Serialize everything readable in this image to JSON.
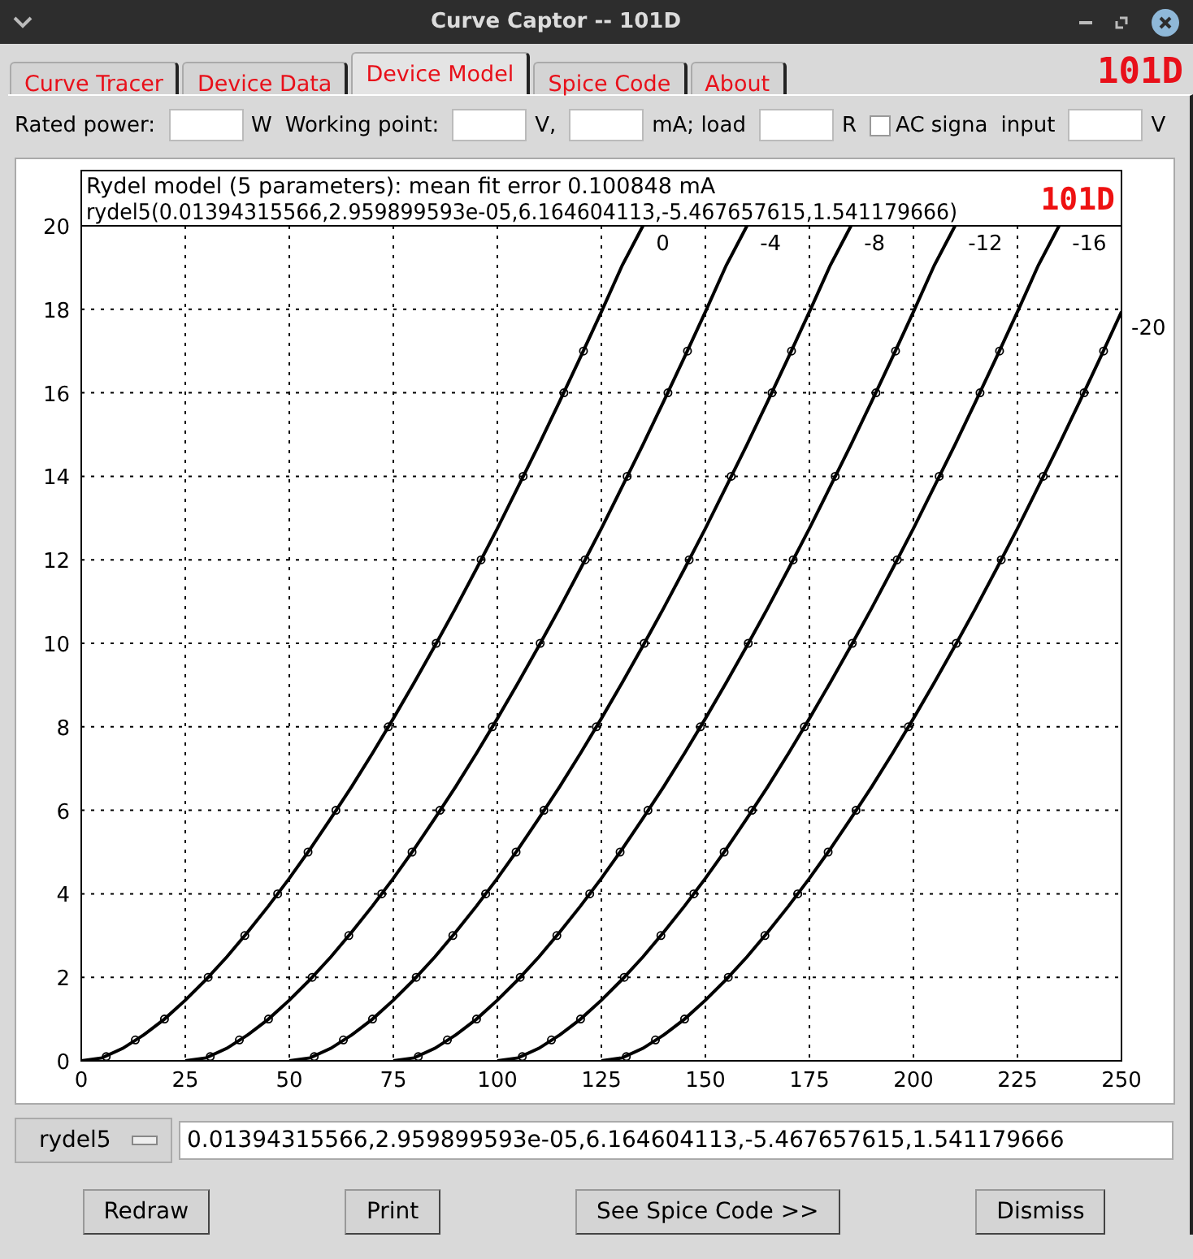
{
  "window": {
    "title": "Curve Captor -- 101D"
  },
  "tabs": [
    {
      "label": "Curve Tracer",
      "selected": false
    },
    {
      "label": "Device Data",
      "selected": false
    },
    {
      "label": "Device Model",
      "selected": true
    },
    {
      "label": "Spice Code",
      "selected": false
    },
    {
      "label": "About",
      "selected": false
    }
  ],
  "device_badge": "101D",
  "form": [
    {
      "kind": "label",
      "text": "Rated power:"
    },
    {
      "kind": "field"
    },
    {
      "kind": "label",
      "text": "W"
    },
    {
      "kind": "label",
      "text": "Working point:"
    },
    {
      "kind": "field"
    },
    {
      "kind": "label",
      "text": "V,"
    },
    {
      "kind": "field"
    },
    {
      "kind": "label",
      "text": "mA; load"
    },
    {
      "kind": "field"
    },
    {
      "kind": "label",
      "text": "R"
    },
    {
      "kind": "checkbox",
      "text": "AC signa",
      "checked": false
    },
    {
      "kind": "label",
      "text": "input"
    },
    {
      "kind": "field"
    },
    {
      "kind": "label",
      "text": "V"
    }
  ],
  "plot": {
    "heading": "Rydel model (5 parameters): mean fit error 0.100848 mA",
    "formula": "rydel5(0.01394315566,2.959899593e-05,6.164604113,-5.467657615,1.541179666)",
    "badge": "101D",
    "chart_data": {
      "type": "line",
      "grid": true,
      "xlim": [
        0,
        250
      ],
      "ylim": [
        0,
        20
      ],
      "xticks": [
        0,
        25,
        50,
        75,
        100,
        125,
        150,
        175,
        200,
        225,
        250
      ],
      "yticks": [
        0,
        2,
        4,
        6,
        8,
        10,
        12,
        14,
        16,
        18,
        20
      ],
      "x": [
        0,
        5,
        10,
        15,
        20,
        25,
        30,
        35,
        40,
        45,
        50,
        55,
        60,
        65,
        70,
        75,
        80,
        85,
        90,
        95,
        100,
        105,
        110,
        115,
        120,
        125,
        130,
        135,
        140,
        145,
        150,
        155,
        160,
        165,
        170,
        175,
        180,
        185,
        190,
        195,
        200,
        205,
        210,
        215,
        220,
        225,
        230,
        235,
        240,
        245,
        250
      ],
      "series": [
        {
          "name": "0",
          "values": [
            0,
            0.07,
            0.3,
            0.62,
            1.0,
            1.45,
            1.95,
            2.49,
            3.08,
            3.71,
            4.37,
            5.07,
            5.81,
            6.57,
            7.37,
            8.2,
            9.06,
            9.94,
            10.85,
            11.79,
            12.75,
            13.75,
            14.76,
            15.8,
            16.86,
            17.94,
            19.05,
            20,
            null,
            null,
            null,
            null,
            null,
            null,
            null,
            null,
            null,
            null,
            null,
            null,
            null,
            null,
            null,
            null,
            null,
            null,
            null,
            null,
            null,
            null,
            null
          ]
        },
        {
          "name": "-4",
          "values": [
            null,
            null,
            null,
            null,
            null,
            0,
            0.07,
            0.3,
            0.62,
            1.0,
            1.45,
            1.95,
            2.49,
            3.08,
            3.71,
            4.37,
            5.07,
            5.81,
            6.57,
            7.37,
            8.2,
            9.06,
            9.94,
            10.85,
            11.79,
            12.75,
            13.75,
            14.76,
            15.8,
            16.86,
            17.94,
            19.05,
            20,
            null,
            null,
            null,
            null,
            null,
            null,
            null,
            null,
            null,
            null,
            null,
            null,
            null,
            null,
            null,
            null,
            null,
            null
          ]
        },
        {
          "name": "-8",
          "values": [
            null,
            null,
            null,
            null,
            null,
            null,
            null,
            null,
            null,
            null,
            0,
            0.07,
            0.3,
            0.62,
            1.0,
            1.45,
            1.95,
            2.49,
            3.08,
            3.71,
            4.37,
            5.07,
            5.81,
            6.57,
            7.37,
            8.2,
            9.06,
            9.94,
            10.85,
            11.79,
            12.75,
            13.75,
            14.76,
            15.8,
            16.86,
            17.94,
            19.05,
            20,
            null,
            null,
            null,
            null,
            null,
            null,
            null,
            null,
            null,
            null,
            null,
            null,
            null
          ]
        },
        {
          "name": "-12",
          "values": [
            null,
            null,
            null,
            null,
            null,
            null,
            null,
            null,
            null,
            null,
            null,
            null,
            null,
            null,
            null,
            0,
            0.07,
            0.3,
            0.62,
            1.0,
            1.45,
            1.95,
            2.49,
            3.08,
            3.71,
            4.37,
            5.07,
            5.81,
            6.57,
            7.37,
            8.2,
            9.06,
            9.94,
            10.85,
            11.79,
            12.75,
            13.75,
            14.76,
            15.8,
            16.86,
            17.94,
            19.05,
            20,
            null,
            null,
            null,
            null,
            null,
            null,
            null,
            null
          ]
        },
        {
          "name": "-16",
          "values": [
            null,
            null,
            null,
            null,
            null,
            null,
            null,
            null,
            null,
            null,
            null,
            null,
            null,
            null,
            null,
            null,
            null,
            null,
            null,
            null,
            0,
            0.07,
            0.3,
            0.62,
            1.0,
            1.45,
            1.95,
            2.49,
            3.08,
            3.71,
            4.37,
            5.07,
            5.81,
            6.57,
            7.37,
            8.2,
            9.06,
            9.94,
            10.85,
            11.79,
            12.75,
            13.75,
            14.76,
            15.8,
            16.86,
            17.94,
            19.05,
            20,
            null,
            null,
            null
          ]
        },
        {
          "name": "-20",
          "values": [
            null,
            null,
            null,
            null,
            null,
            null,
            null,
            null,
            null,
            null,
            null,
            null,
            null,
            null,
            null,
            null,
            null,
            null,
            null,
            null,
            null,
            null,
            null,
            null,
            null,
            0,
            0.07,
            0.3,
            0.62,
            1.0,
            1.45,
            1.95,
            2.49,
            3.08,
            3.71,
            4.37,
            5.07,
            5.81,
            6.57,
            7.37,
            8.2,
            9.06,
            9.94,
            10.85,
            11.79,
            12.75,
            13.75,
            14.76,
            15.8,
            16.86,
            17.94
          ]
        }
      ]
    }
  },
  "measured": {
    "chart_data": {
      "type": "scatter",
      "xlim": [
        0,
        250
      ],
      "ylim": [
        0,
        20
      ],
      "x": [
        6,
        13,
        20,
        30.5,
        39.3,
        47.2,
        54.5,
        61.2,
        73.8,
        85.3,
        96.1,
        106.2,
        116,
        120.7,
        31,
        38,
        45,
        55.5,
        64.3,
        72.2,
        79.5,
        86.2,
        98.8,
        110.3,
        121.1,
        131.2,
        141,
        145.7,
        56,
        63,
        70,
        80.5,
        89.3,
        97.2,
        104.5,
        111.2,
        123.8,
        135.3,
        146.1,
        156.2,
        166,
        170.7,
        81,
        88,
        95,
        105.5,
        114.3,
        122.2,
        129.5,
        136.2,
        148.8,
        160.3,
        171.1,
        181.2,
        191,
        195.7,
        106,
        113,
        120,
        130.5,
        139.3,
        147.2,
        154.5,
        161.2,
        173.8,
        185.3,
        196.1,
        206.2,
        216,
        220.7,
        131,
        138,
        145,
        155.5,
        164.3,
        172.2,
        179.5,
        186.2,
        198.8,
        210.3,
        221.1,
        231.2,
        241,
        245.7
      ],
      "values": [
        0.1,
        0.5,
        1,
        2,
        3,
        4,
        5,
        6,
        8,
        10,
        12,
        14,
        16,
        17,
        0.1,
        0.5,
        1,
        2,
        3,
        4,
        5,
        6,
        8,
        10,
        12,
        14,
        16,
        17,
        0.1,
        0.5,
        1,
        2,
        3,
        4,
        5,
        6,
        8,
        10,
        12,
        14,
        16,
        17,
        0.1,
        0.5,
        1,
        2,
        3,
        4,
        5,
        6,
        8,
        10,
        12,
        14,
        16,
        17,
        0.1,
        0.5,
        1,
        2,
        3,
        4,
        5,
        6,
        8,
        10,
        12,
        14,
        16,
        17,
        0.1,
        0.5,
        1,
        2,
        3,
        4,
        5,
        6,
        8,
        10,
        12,
        14,
        16,
        17
      ]
    }
  },
  "model_select": {
    "value": "rydel5"
  },
  "parameters_field": {
    "value": "0.01394315566,2.959899593e-05,6.164604113,-5.467657615,1.541179666"
  },
  "buttons": [
    "Redraw",
    "Print",
    "See Spice Code >>",
    "Dismiss"
  ]
}
